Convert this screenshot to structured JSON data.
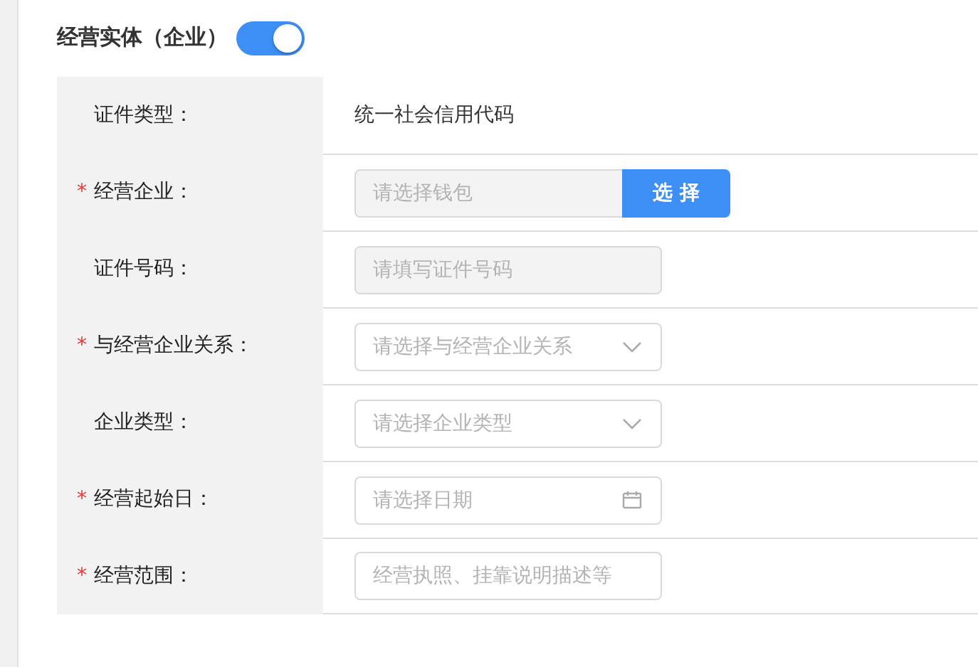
{
  "section": {
    "title": "经营实体（企业）",
    "switch_on": true
  },
  "rows": [
    {
      "label": "证件类型：",
      "required": false,
      "kind": "text",
      "value": "统一社会信用代码"
    },
    {
      "label": "经营企业：",
      "required": true,
      "kind": "picker",
      "placeholder": "请选择钱包",
      "disabled": true,
      "button": "选 择"
    },
    {
      "label": "证件号码：",
      "required": false,
      "kind": "input",
      "placeholder": "请填写证件号码",
      "disabled": true
    },
    {
      "label": "与经营企业关系：",
      "required": true,
      "kind": "select",
      "placeholder": "请选择与经营企业关系",
      "disabled": false
    },
    {
      "label": "企业类型：",
      "required": false,
      "kind": "select",
      "placeholder": "请选择企业类型",
      "disabled": false
    },
    {
      "label": "经营起始日：",
      "required": true,
      "kind": "date",
      "placeholder": "请选择日期",
      "disabled": false
    },
    {
      "label": "经营范围：",
      "required": true,
      "kind": "input",
      "placeholder": "经营执照、挂靠说明描述等",
      "disabled": false
    }
  ],
  "required_mark": "*"
}
